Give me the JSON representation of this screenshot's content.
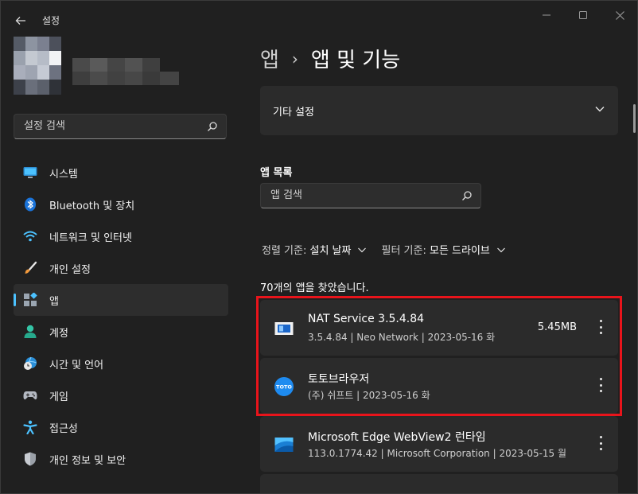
{
  "window": {
    "title": "설정"
  },
  "search": {
    "placeholder": "설정 검색"
  },
  "nav": {
    "items": [
      {
        "label": "시스템",
        "icon": "system-icon"
      },
      {
        "label": "Bluetooth 및 장치",
        "icon": "bluetooth-icon"
      },
      {
        "label": "네트워크 및 인터넷",
        "icon": "wifi-icon"
      },
      {
        "label": "개인 설정",
        "icon": "brush-icon"
      },
      {
        "label": "앱",
        "icon": "apps-icon",
        "active": true
      },
      {
        "label": "계정",
        "icon": "account-icon"
      },
      {
        "label": "시간 및 언어",
        "icon": "clock-globe-icon"
      },
      {
        "label": "게임",
        "icon": "gamepad-icon"
      },
      {
        "label": "접근성",
        "icon": "accessibility-icon"
      },
      {
        "label": "개인 정보 및 보안",
        "icon": "shield-icon"
      }
    ]
  },
  "breadcrumb": {
    "parent": "앱",
    "separator": "›",
    "current": "앱 및 기능"
  },
  "other_settings": {
    "label": "기타 설정"
  },
  "app_list": {
    "title": "앱 목록",
    "search_placeholder": "앱 검색",
    "sort_label": "정렬 기준:",
    "sort_value": "설치 날짜",
    "filter_label": "필터 기준:",
    "filter_value": "모든 드라이브",
    "count_text": "70개의 앱을 찾았습니다.",
    "apps": [
      {
        "name": "NAT Service 3.5.4.84",
        "meta": "3.5.4.84  |  Neo Network  |  2023-05-16 화",
        "size": "5.45MB",
        "icon": "nat-service-icon"
      },
      {
        "name": "토토브라우저",
        "meta": "(주) 쉬프트  |  2023-05-16 화",
        "size": "",
        "icon": "toto-browser-icon",
        "icon_text": "TOTO"
      },
      {
        "name": "Microsoft Edge WebView2 런타임",
        "meta": "113.0.1774.42  |  Microsoft Corporation  |  2023-05-15 월",
        "size": "",
        "icon": "edge-webview-icon"
      }
    ]
  },
  "colors": {
    "accent": "#4cc2ff",
    "highlight": "#e8141b",
    "background": "#202020",
    "card": "#2b2b2b"
  }
}
